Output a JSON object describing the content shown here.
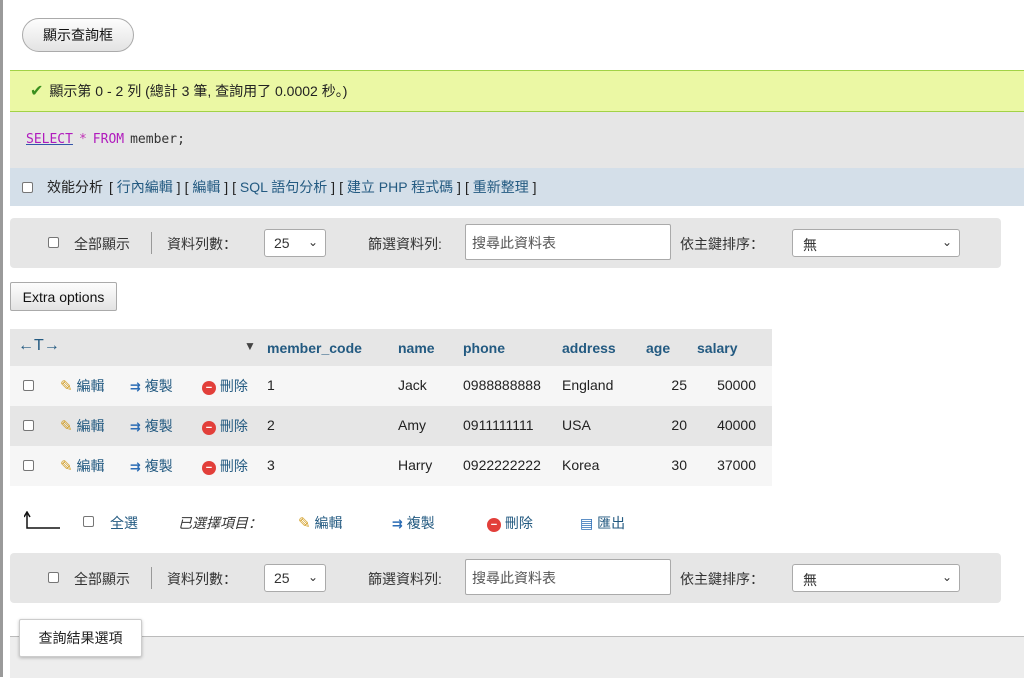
{
  "toolbar": {
    "show_query_label": "顯示查詢框"
  },
  "success": {
    "icon": "check-icon",
    "message": "顯示第 0 - 2 列 (總計 3 筆, 查詢用了 0.0002 秒。)"
  },
  "sql": {
    "select": "SELECT",
    "star": "*",
    "from": "FROM",
    "table": "member;"
  },
  "profiling": {
    "label": "效能分析",
    "links": [
      "行內編輯",
      "編輯",
      "SQL 語句分析",
      "建立 PHP 程式碼",
      "重新整理"
    ]
  },
  "navigation": {
    "show_all": "全部顯示",
    "rows_label": "資料列數：",
    "rows_value": "25",
    "filter_label": "篩選資料列:",
    "filter_placeholder": "搜尋此資料表",
    "sort_label": "依主鍵排序：",
    "sort_value": "無"
  },
  "extra_options_label": "Extra options",
  "table": {
    "arrows": "←T→",
    "sort_indicator": "▼",
    "columns": [
      "member_code",
      "name",
      "phone",
      "address",
      "age",
      "salary"
    ],
    "actions": {
      "edit": "編輯",
      "copy": "複製",
      "delete": "刪除"
    },
    "rows": [
      {
        "member_code": "1",
        "name": "Jack",
        "phone": "0988888888",
        "address": "England",
        "age": "25",
        "salary": "50000"
      },
      {
        "member_code": "2",
        "name": "Amy",
        "phone": "0911111111",
        "address": "USA",
        "age": "20",
        "salary": "40000"
      },
      {
        "member_code": "3",
        "name": "Harry",
        "phone": "0922222222",
        "address": "Korea",
        "age": "30",
        "salary": "37000"
      }
    ]
  },
  "bulk": {
    "select_all": "全選",
    "selected_label": "已選擇項目：",
    "edit": "編輯",
    "copy": "複製",
    "delete": "刪除",
    "export": "匯出"
  },
  "query_results_options": "查詢結果選項",
  "colors": {
    "success_bg": "#ebf8a4",
    "header_link": "#235a81",
    "keyword": "#b01bbd"
  }
}
